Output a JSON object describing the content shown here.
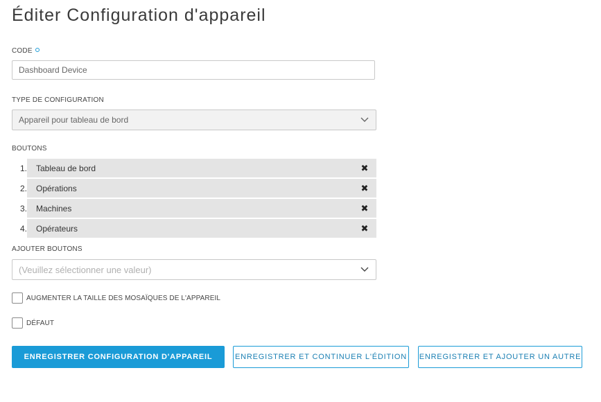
{
  "page": {
    "title": "Éditer Configuration d'appareil"
  },
  "form": {
    "code": {
      "label": "Code",
      "value": "Dashboard Device"
    },
    "config_type": {
      "label": "Type de configuration",
      "value": "Appareil pour tableau de bord"
    },
    "buttons": {
      "label": "Boutons",
      "items": [
        {
          "num": "1.",
          "label": "Tableau de bord"
        },
        {
          "num": "2.",
          "label": "Opérations"
        },
        {
          "num": "3.",
          "label": "Machines"
        },
        {
          "num": "4.",
          "label": "Opérateurs"
        }
      ],
      "remove_glyph": "✖"
    },
    "add_buttons": {
      "label": "Ajouter boutons",
      "placeholder": "(Veuillez sélectionner une valeur)"
    },
    "increase_tiles": {
      "label": "Augmenter la taille des mosaïques de l'appareil",
      "checked": false
    },
    "default": {
      "label": "Défaut",
      "checked": false
    }
  },
  "actions": {
    "save": "Enregistrer Configuration d'appareil",
    "save_continue": "Enregistrer et continuer l'édition",
    "save_add_another": "Enregistrer et ajouter un autre"
  },
  "colors": {
    "accent": "#1a9bd7",
    "chip_bg": "#e4e4e4"
  }
}
